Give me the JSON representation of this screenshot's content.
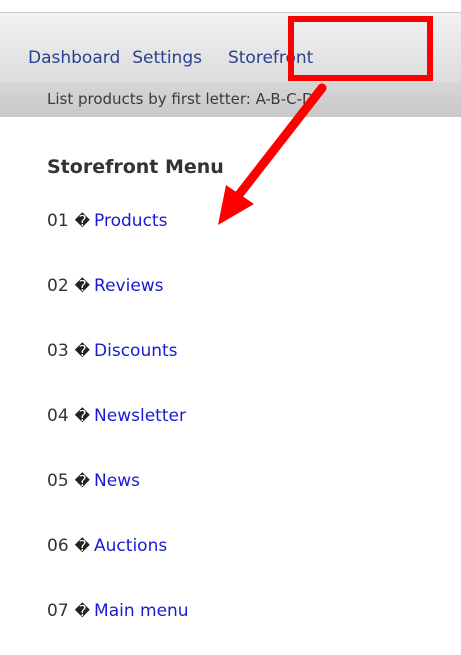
{
  "nav": {
    "items": [
      {
        "label": "Dashboard"
      },
      {
        "label": "Settings"
      },
      {
        "label": "Storefront"
      }
    ]
  },
  "subbar": {
    "text": "List products by first letter: A-B-C-D-"
  },
  "menu": {
    "title": "Storefront Menu",
    "separator": "&#65533;",
    "items": [
      {
        "number": "01",
        "label": "Products"
      },
      {
        "number": "02",
        "label": "Reviews"
      },
      {
        "number": "03",
        "label": "Discounts"
      },
      {
        "number": "04",
        "label": "Newsletter"
      },
      {
        "number": "05",
        "label": "News"
      },
      {
        "number": "06",
        "label": "Auctions"
      },
      {
        "number": "07",
        "label": "Main menu"
      }
    ]
  },
  "annotation": {
    "color": "#ff0000"
  }
}
